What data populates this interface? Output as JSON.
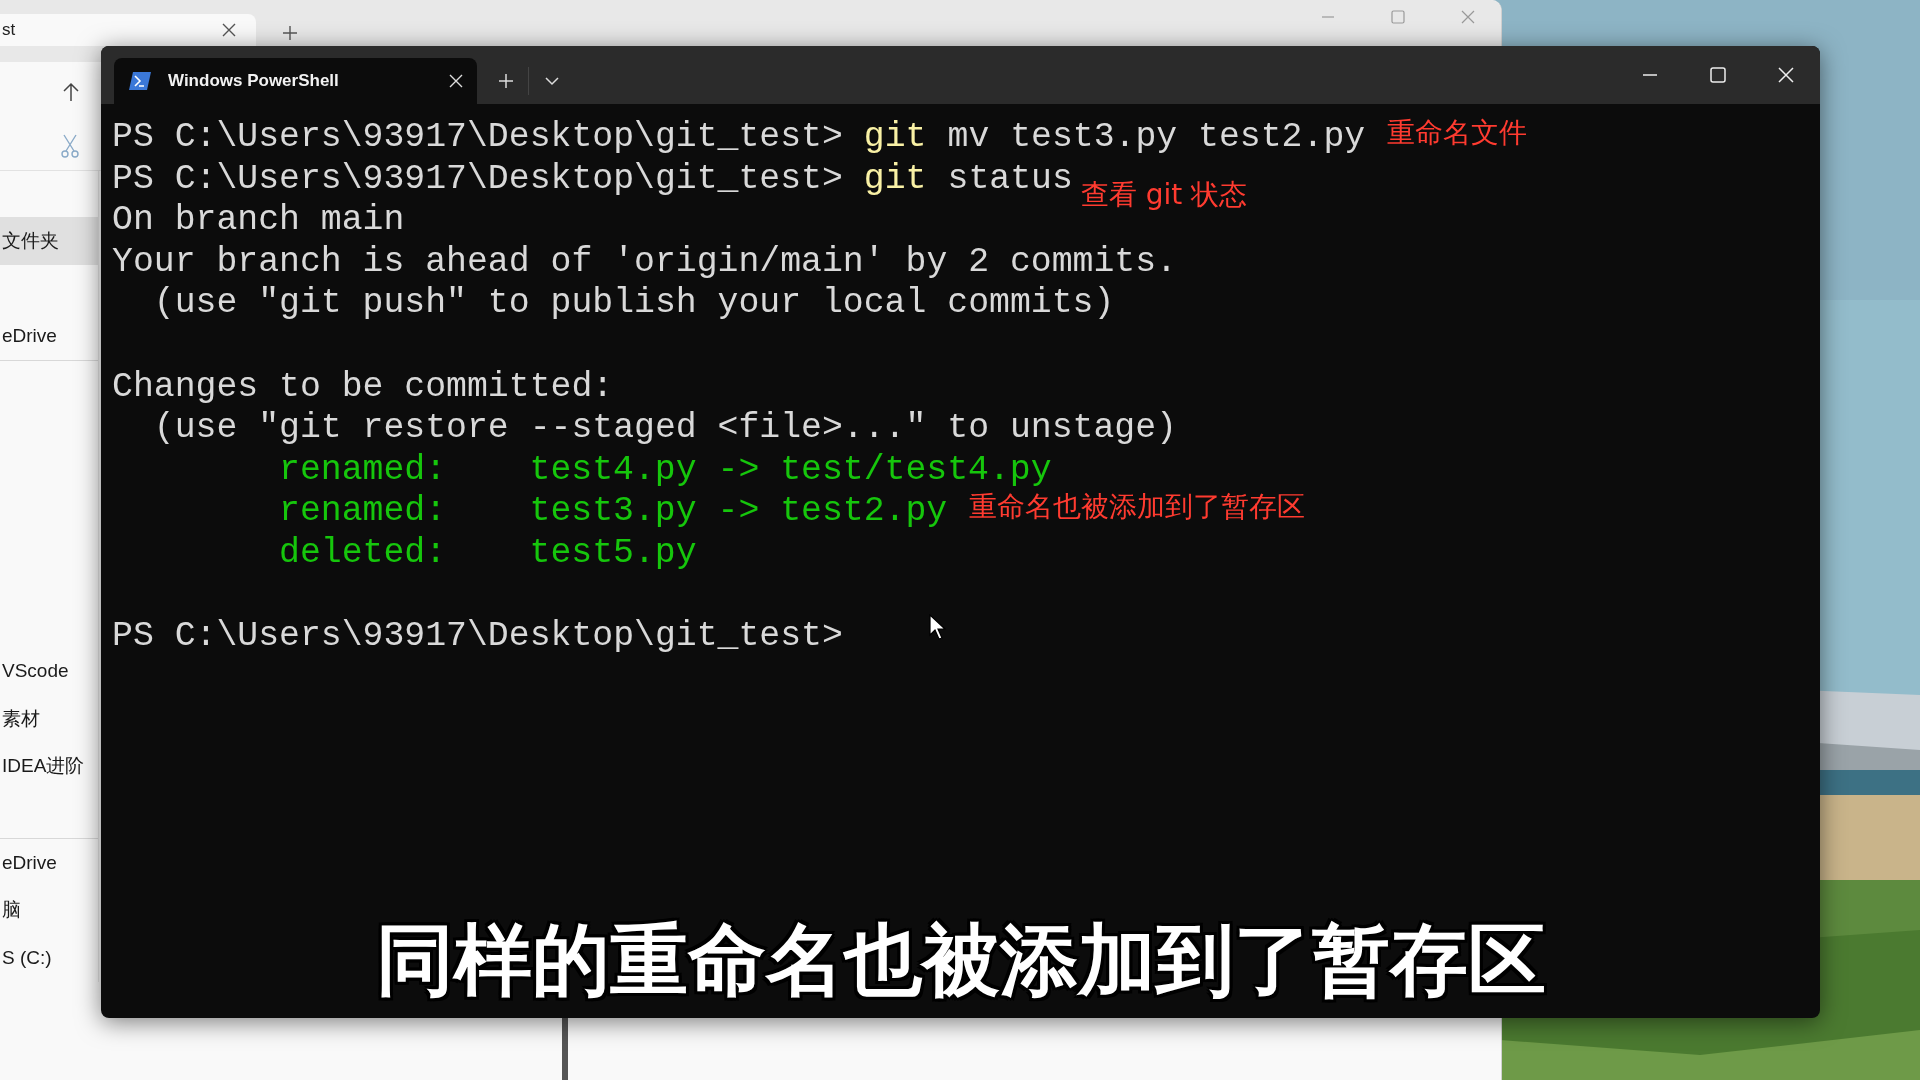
{
  "explorer": {
    "tab_title": "st",
    "sidebar": {
      "items": [
        {
          "label": "文件夹",
          "selected": true
        },
        {
          "kind": "cut_off"
        },
        {
          "label": "eDrive",
          "selected": false
        },
        {
          "kind": "divider"
        },
        {
          "kind": "cut_off"
        },
        {
          "kind": "cut_off"
        },
        {
          "kind": "cut_off"
        },
        {
          "kind": "cut_off"
        },
        {
          "kind": "cut_off"
        },
        {
          "kind": "cut_off"
        },
        {
          "label": "VScode",
          "selected": false
        },
        {
          "label": "素材",
          "selected": false
        },
        {
          "label": "IDEA进阶",
          "selected": false
        },
        {
          "kind": "cut_off"
        },
        {
          "kind": "divider"
        },
        {
          "label": "eDrive",
          "selected": false
        },
        {
          "label": "脑",
          "selected": false
        },
        {
          "label": "S (C:)",
          "selected": false
        }
      ]
    }
  },
  "terminal": {
    "tab": {
      "title": "Windows PowerShell"
    },
    "lines": [
      {
        "kind": "command",
        "prompt": "PS C:\\Users\\93917\\Desktop\\git_test>",
        "command": "git",
        "args": "mv test3.py test2.py",
        "note": "重命名文件"
      },
      {
        "kind": "command",
        "prompt": "PS C:\\Users\\93917\\Desktop\\git_test>",
        "command": "git",
        "args": "status",
        "note": "查看 git 状态"
      },
      {
        "kind": "output",
        "text": "On branch main"
      },
      {
        "kind": "output",
        "text": "Your branch is ahead of 'origin/main' by 2 commits."
      },
      {
        "kind": "output",
        "text": "  (use \"git push\" to publish your local commits)"
      },
      {
        "kind": "blank"
      },
      {
        "kind": "output",
        "text": "Changes to be committed:"
      },
      {
        "kind": "output",
        "text": "  (use \"git restore --staged <file>...\" to unstage)"
      },
      {
        "kind": "change",
        "text": "renamed:    test4.py -> test/test4.py"
      },
      {
        "kind": "change",
        "text": "renamed:    test3.py -> test2.py",
        "note": "重命名也被添加到了暂存区"
      },
      {
        "kind": "change",
        "text": "deleted:    test5.py"
      },
      {
        "kind": "blank"
      },
      {
        "kind": "prompt",
        "prompt": "PS C:\\Users\\93917\\Desktop\\git_test>"
      }
    ]
  },
  "subtitle": "同样的重命名也被添加到了暂存区"
}
